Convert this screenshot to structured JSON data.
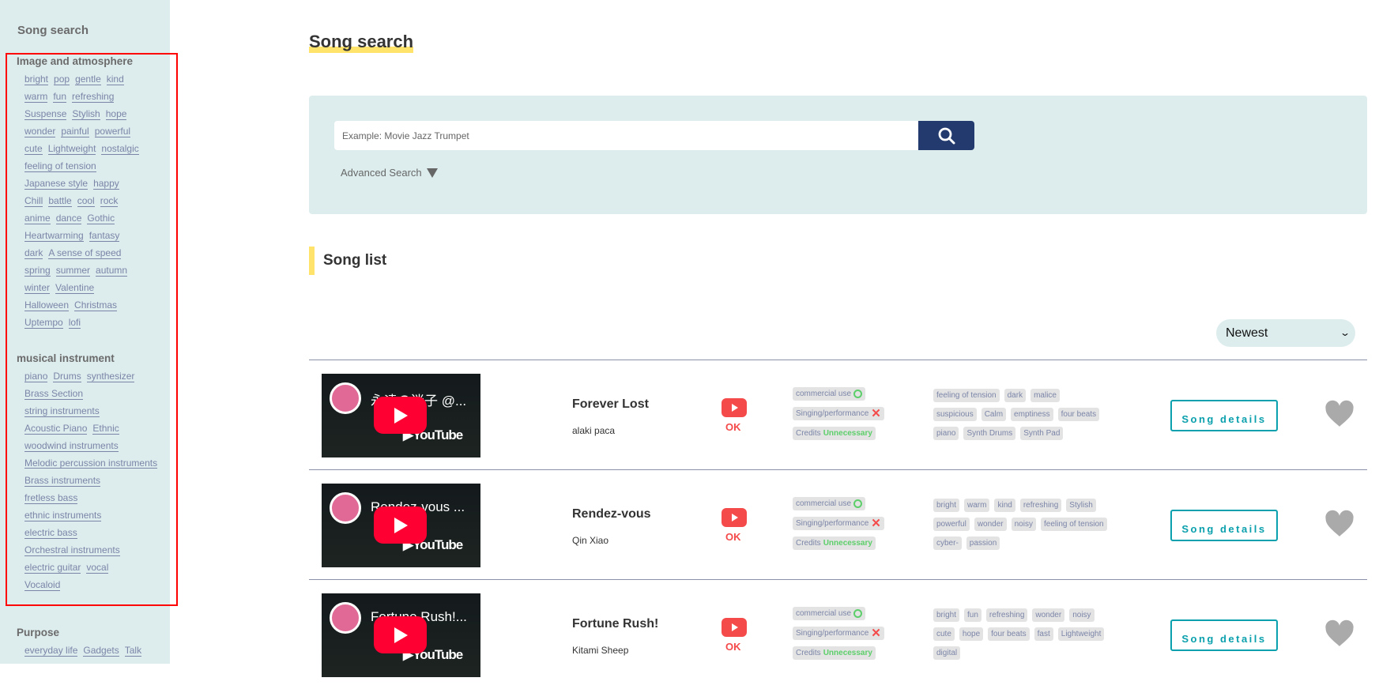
{
  "sidebar": {
    "title": "Song search",
    "categories": [
      {
        "heading": "Image and atmosphere",
        "tags": [
          "bright",
          "pop",
          "gentle",
          "kind",
          "warm",
          "fun",
          "refreshing",
          "Suspense",
          "Stylish",
          "hope",
          "wonder",
          "painful",
          "powerful",
          "cute",
          "Lightweight",
          "nostalgic",
          "feeling of tension",
          "Japanese style",
          "happy",
          "Chill",
          "battle",
          "cool",
          "rock",
          "anime",
          "dance",
          "Gothic",
          "Heartwarming",
          "fantasy",
          "dark",
          "A sense of speed",
          "spring",
          "summer",
          "autumn",
          "winter",
          "Valentine",
          "Halloween",
          "Christmas",
          "Uptempo",
          "lofi"
        ]
      },
      {
        "heading": "musical instrument",
        "tags": [
          "piano",
          "Drums",
          "synthesizer",
          "Brass Section",
          "string instruments",
          "Acoustic Piano",
          "Ethnic",
          "woodwind instruments",
          "Melodic percussion instruments",
          "Brass instruments",
          "fretless bass",
          "ethnic instruments",
          "electric bass",
          "Orchestral instruments",
          "electric guitar",
          "vocal",
          "Vocaloid"
        ]
      },
      {
        "heading": "Purpose",
        "tags": [
          "everyday life",
          "Gadgets",
          "Talk"
        ]
      }
    ]
  },
  "main": {
    "title": "Song search",
    "search_placeholder": "Example: Movie Jazz Trumpet",
    "advanced_search": "Advanced Search",
    "list_title": "Song list",
    "sort_selected": "Newest"
  },
  "colors": {
    "accent_yellow": "#ffe36b",
    "search_button": "#223a6e",
    "details_button": "#0aa0ad",
    "ok_red": "#f44a4a",
    "tag_text": "#7b85a8"
  },
  "songs": [
    {
      "video_title": "永遠の迷子 @...",
      "title": "Forever Lost",
      "artist": "alaki paca",
      "ok": "OK",
      "licenses": {
        "commercial": "commercial use",
        "singing": "Singing/performance",
        "credits_label": "Credits",
        "credits_value": "Unnecessary"
      },
      "tags": [
        "feeling of tension",
        "dark",
        "malice",
        "suspicious",
        "Calm",
        "emptiness",
        "four beats",
        "piano",
        "Synth Drums",
        "Synth Pad"
      ],
      "details": "Song details"
    },
    {
      "video_title": "Rendez-vous ...",
      "title": "Rendez-vous",
      "artist": "Qin Xiao",
      "ok": "OK",
      "licenses": {
        "commercial": "commercial use",
        "singing": "Singing/performance",
        "credits_label": "Credits",
        "credits_value": "Unnecessary"
      },
      "tags": [
        "bright",
        "warm",
        "kind",
        "refreshing",
        "Stylish",
        "powerful",
        "wonder",
        "noisy",
        "feeling of tension",
        "cyber-",
        "passion"
      ],
      "details": "Song details"
    },
    {
      "video_title": "Fortune Rush!...",
      "title": "Fortune Rush!",
      "artist": "Kitami Sheep",
      "ok": "OK",
      "licenses": {
        "commercial": "commercial use",
        "singing": "Singing/performance",
        "credits_label": "Credits",
        "credits_value": "Unnecessary"
      },
      "tags": [
        "bright",
        "fun",
        "refreshing",
        "wonder",
        "noisy",
        "cute",
        "hope",
        "four beats",
        "fast",
        "Lightweight",
        "digital"
      ],
      "details": "Song details"
    }
  ]
}
